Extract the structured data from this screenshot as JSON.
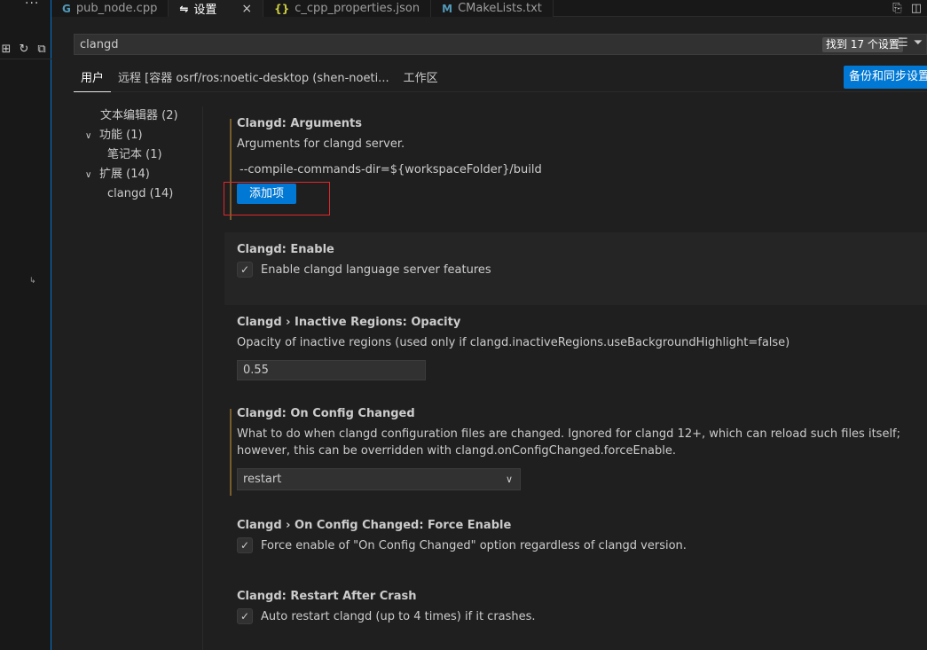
{
  "tabs": [
    {
      "label": "pub_node.cpp",
      "icon": "C+",
      "icon_color": "#519aba",
      "active": false
    },
    {
      "label": "设置",
      "icon": "≈",
      "icon_color": "#cccccc",
      "active": true,
      "close": "×"
    },
    {
      "label": "c_cpp_properties.json",
      "icon": "{}",
      "icon_color": "#cbcb41",
      "active": false
    },
    {
      "label": "CMakeLists.txt",
      "icon": "M",
      "icon_color": "#6d8086",
      "active": false
    }
  ],
  "left_strip": {
    "dots": "···"
  },
  "search": {
    "value": "clangd",
    "count": "找到 17 个设置"
  },
  "scope_tabs": [
    "用户",
    "远程 [容器 osrf/ros:noetic-desktop (shen-noeti...",
    "工作区"
  ],
  "sync_button": "备份和同步设置",
  "toc": [
    {
      "label": "文本编辑器 (2)",
      "chevron": "",
      "indent": 1
    },
    {
      "label": "功能 (1)",
      "chevron": "∨",
      "indent": 0
    },
    {
      "label": "笔记本 (1)",
      "chevron": "",
      "indent": 2
    },
    {
      "label": "扩展 (14)",
      "chevron": "∨",
      "indent": 0
    },
    {
      "label": "clangd (14)",
      "chevron": "",
      "indent": 2
    }
  ],
  "settings": {
    "arguments": {
      "category": "Clangd: ",
      "name": "Arguments",
      "description": "Arguments for clangd server.",
      "value": "--compile-commands-dir=${workspaceFolder}/build",
      "add_button": "添加项"
    },
    "enable": {
      "category": "Clangd: ",
      "name": "Enable",
      "checkbox_label": "Enable clangd language server features",
      "checked": true
    },
    "opacity": {
      "category": "Clangd › Inactive Regions: ",
      "name": "Opacity",
      "description": "Opacity of inactive regions (used only if clangd.inactiveRegions.useBackgroundHighlight=false)",
      "value": "0.55"
    },
    "on_config_changed": {
      "category": "Clangd: ",
      "name": "On Config Changed",
      "description": "What to do when clangd configuration files are changed. Ignored for clangd 12+, which can reload such files itself; however, this can be overridden with clangd.onConfigChanged.forceEnable.",
      "value": "restart"
    },
    "force_enable": {
      "category": "Clangd › On Config Changed: ",
      "name": "Force Enable",
      "checkbox_label": "Force enable of \"On Config Changed\" option regardless of clangd version.",
      "checked": true
    },
    "restart_after_crash": {
      "category": "Clangd: ",
      "name": "Restart After Crash",
      "checkbox_label": "Auto restart clangd (up to 4 times) if it crashes.",
      "checked": true
    }
  },
  "colors": {
    "accent": "#0078d4",
    "highlight_box": "#e0272d",
    "modified_bar": "#775d2b"
  }
}
